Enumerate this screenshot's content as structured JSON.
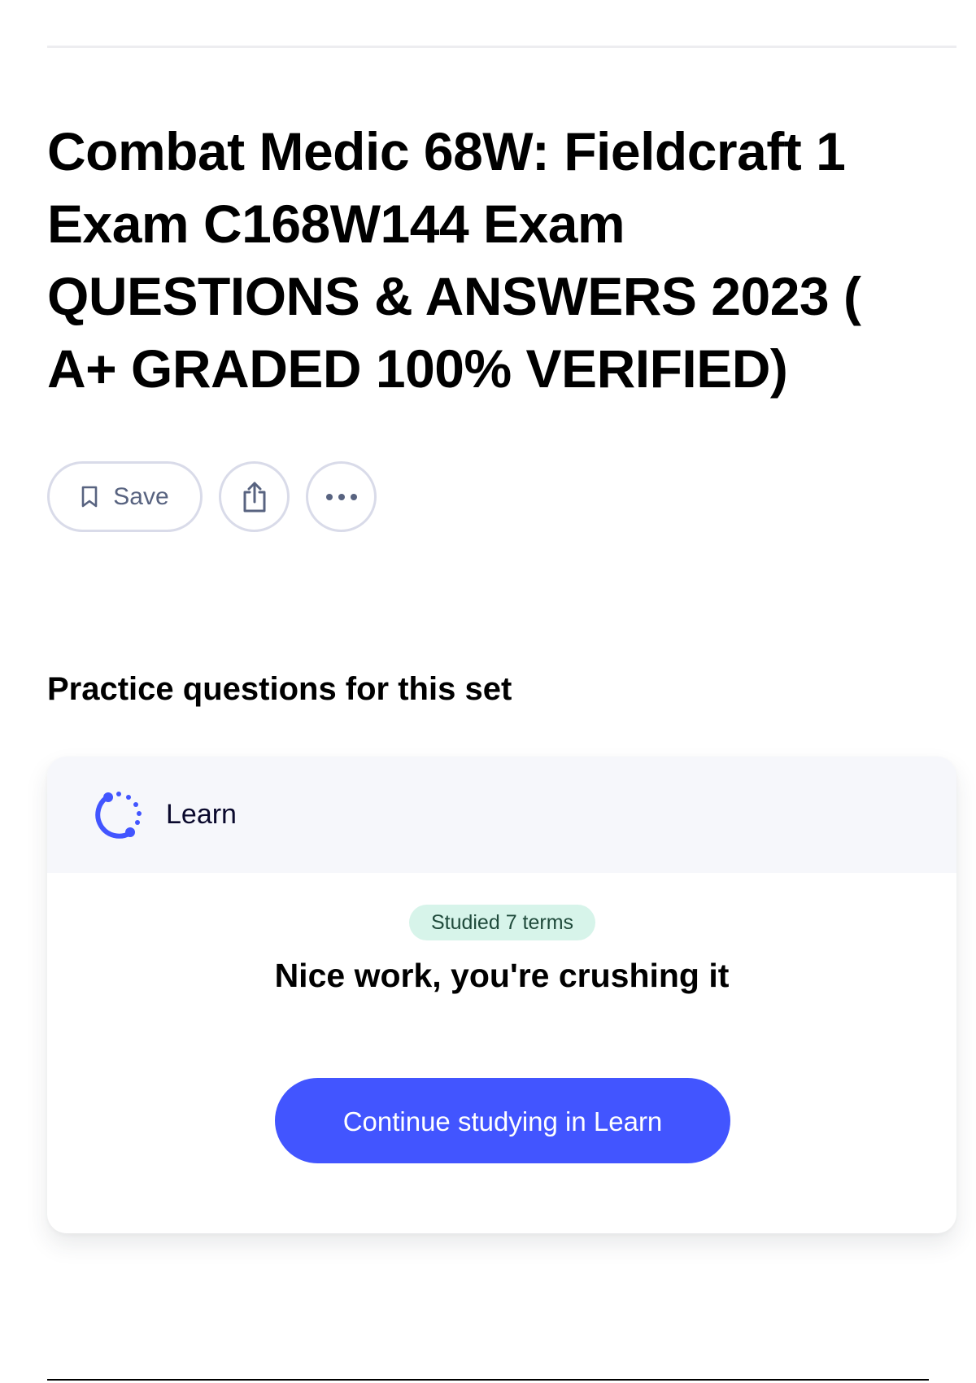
{
  "header": {
    "title": "Combat Medic 68W: Fieldcraft 1 Exam C168W144 Exam QUESTIONS & ANSWERS 2023 ( A+ GRADED 100% VERIFIED)"
  },
  "actions": {
    "save_label": "Save",
    "icons": [
      "bookmark-icon",
      "share-icon",
      "more-icon"
    ]
  },
  "practice": {
    "heading": "Practice questions for this set",
    "mode_label": "Learn",
    "mode_icon": "learn-icon",
    "badge": "Studied 7 terms",
    "message": "Nice work, you're crushing it",
    "cta_label": "Continue studying in Learn"
  },
  "colors": {
    "accent": "#4255ff",
    "badge_bg": "#d7f4ea",
    "card_header_bg": "#f6f7fb"
  }
}
